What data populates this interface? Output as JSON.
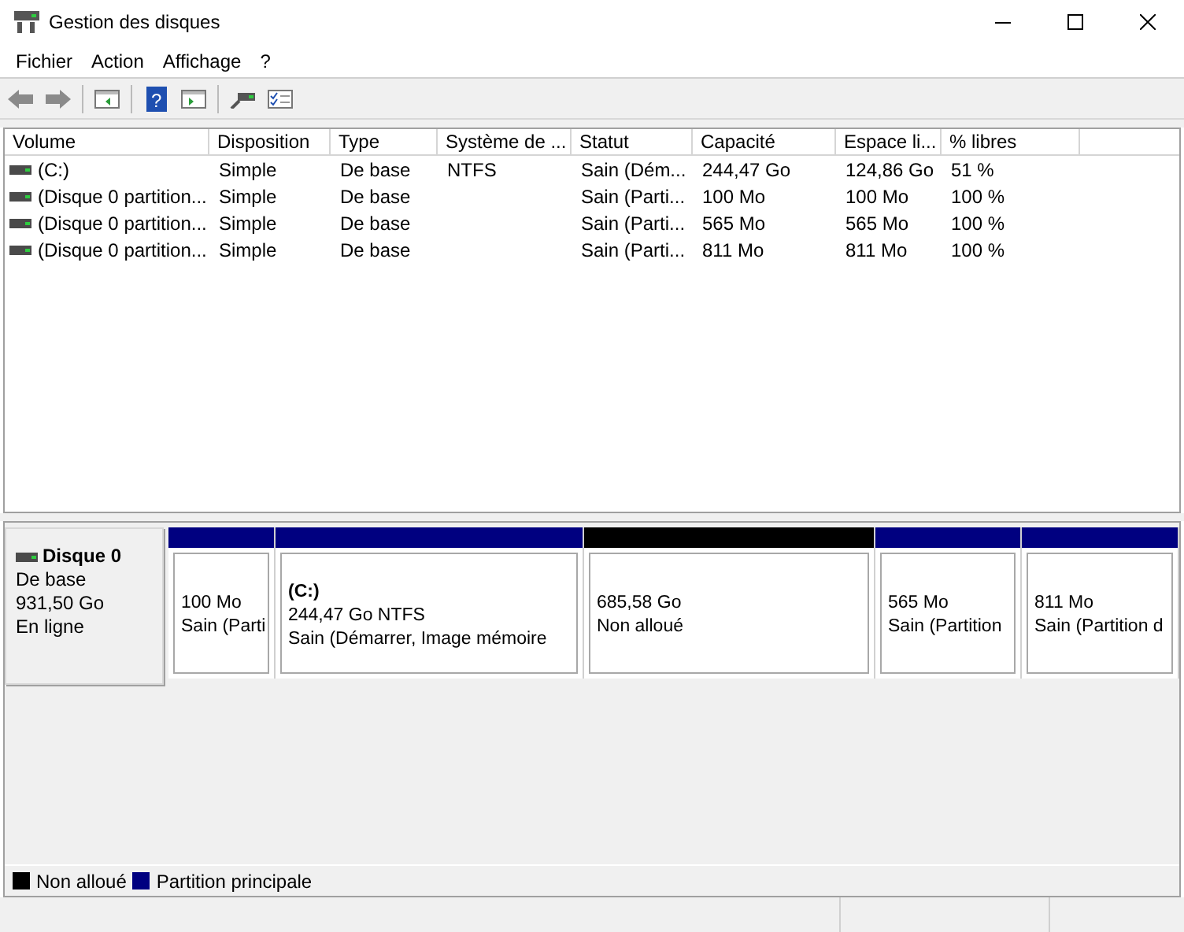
{
  "window": {
    "title": "Gestion des disques"
  },
  "menu": [
    "Fichier",
    "Action",
    "Affichage",
    "?"
  ],
  "toolbar": {
    "help_glyph": "?"
  },
  "table": {
    "columns": [
      "Volume",
      "Disposition",
      "Type",
      "Système de ...",
      "Statut",
      "Capacité",
      "Espace li...",
      "% libres"
    ],
    "rows": [
      [
        "(C:)",
        "Simple",
        "De base",
        "NTFS",
        "Sain (Dém...",
        "244,47 Go",
        "124,86 Go",
        "51 %"
      ],
      [
        "(Disque 0 partition...",
        "Simple",
        "De base",
        "",
        "Sain (Parti...",
        "100 Mo",
        "100 Mo",
        "100 %"
      ],
      [
        "(Disque 0 partition...",
        "Simple",
        "De base",
        "",
        "Sain (Parti...",
        "565 Mo",
        "565 Mo",
        "100 %"
      ],
      [
        "(Disque 0 partition...",
        "Simple",
        "De base",
        "",
        "Sain (Parti...",
        "811 Mo",
        "811 Mo",
        "100 %"
      ]
    ]
  },
  "disk": {
    "name": "Disque 0",
    "type": "De base",
    "size": "931,50 Go",
    "status": "En ligne",
    "segments": [
      {
        "color": "#000080",
        "lines": [
          "100 Mo",
          "Sain (Parti"
        ]
      },
      {
        "color": "#000080",
        "title": "(C:)",
        "lines": [
          "244,47 Go NTFS",
          "Sain (Démarrer, Image mémoire"
        ]
      },
      {
        "color": "#000000",
        "lines": [
          "685,58 Go",
          "Non alloué"
        ]
      },
      {
        "color": "#000080",
        "lines": [
          "565 Mo",
          "Sain (Partition"
        ]
      },
      {
        "color": "#000080",
        "lines": [
          "811 Mo",
          "Sain (Partition d"
        ]
      }
    ]
  },
  "legend": [
    {
      "color": "#000000",
      "label": "Non alloué"
    },
    {
      "color": "#000080",
      "label": "Partition principale"
    }
  ]
}
